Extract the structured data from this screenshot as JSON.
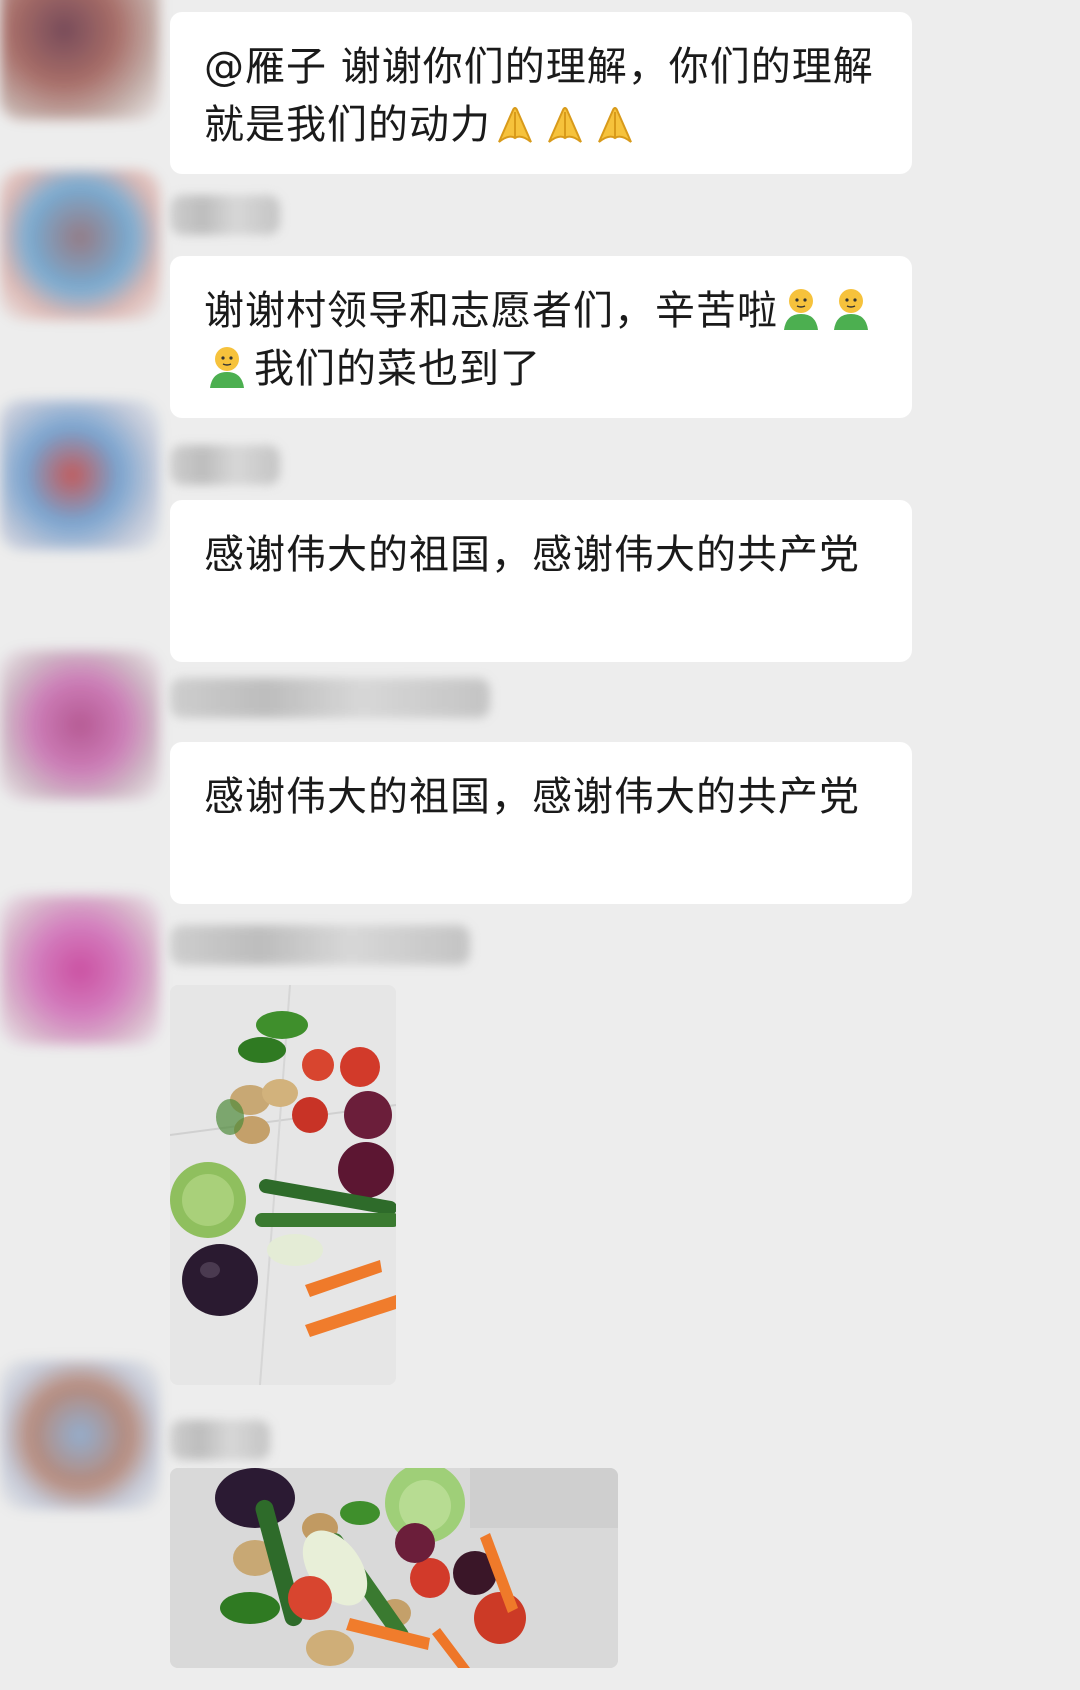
{
  "messages": [
    {
      "text": "@雁子  谢谢你们的理解，你们的理解就是我们的动力",
      "emoji": "folded-hands-icon",
      "emoji_count": 3
    },
    {
      "text_before": "谢谢村领导和志愿者们，辛苦啦",
      "emoji": "person-icon",
      "emoji_count": 3,
      "text_after": "我们的菜也到了"
    },
    {
      "text": "感谢伟大的祖国，感谢伟大的共产党"
    },
    {
      "text": "感谢伟大的祖国，感谢伟大的共产党"
    }
  ],
  "photos": [
    {
      "content": "vegetables-photo"
    },
    {
      "content": "vegetables-photo"
    }
  ],
  "colors": {
    "background": "#ededed",
    "bubble": "#ffffff",
    "text": "#1a1a1a"
  }
}
